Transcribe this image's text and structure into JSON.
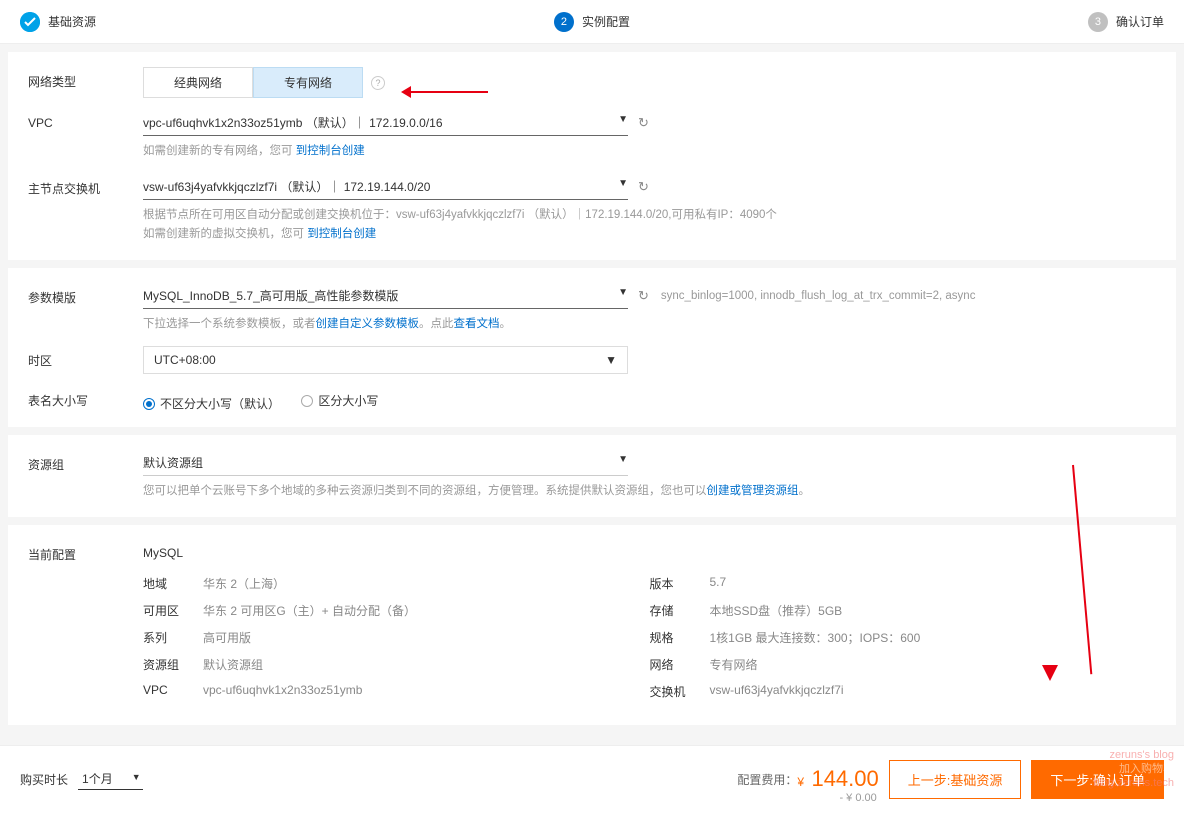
{
  "steps": {
    "s1": "基础资源",
    "s2": "实例配置",
    "s3": "确认订单",
    "n2": "2",
    "n3": "3"
  },
  "network": {
    "label": "网络类型",
    "classic": "经典网络",
    "vpc": "专有网络"
  },
  "vpc": {
    "label": "VPC",
    "value": "vpc-uf6uqhvk1x2n33oz51ymb （默认）｜ 172.19.0.0/16",
    "hint_prefix": "如需创建新的专有网络，您可",
    "hint_link": "到控制台创建"
  },
  "vswitch": {
    "label": "主节点交换机",
    "value": "vsw-uf63j4yafvkkjqczlzf7i （默认）｜ 172.19.144.0/20",
    "hint1": "根据节点所在可用区自动分配或创建交换机位于：vsw-uf63j4yafvkkjqczlzf7i （默认）｜172.19.144.0/20,可用私有IP：4090个",
    "hint2_prefix": "如需创建新的虚拟交换机，您可",
    "hint2_link": "到控制台创建"
  },
  "template": {
    "label": "参数模版",
    "value": "MySQL_InnoDB_5.7_高可用版_高性能参数模版",
    "side": "sync_binlog=1000, innodb_flush_log_at_trx_commit=2, async",
    "hint_prefix": "下拉选择一个系统参数模板，或者",
    "hint_link1": "创建自定义参数模板",
    "hint_mid": "。点此",
    "hint_link2": "查看文档",
    "hint_suffix": "。"
  },
  "tz": {
    "label": "时区",
    "value": "UTC+08:00"
  },
  "tablecase": {
    "label": "表名大小写",
    "opt1": "不区分大小写（默认）",
    "opt2": "区分大小写"
  },
  "resgroup": {
    "label": "资源组",
    "value": "默认资源组",
    "hint_prefix": "您可以把单个云账号下多个地域的多种云资源归类到不同的资源组，方便管理。系统提供默认资源组，您也可以",
    "hint_link": "创建或管理资源组",
    "hint_suffix": "。"
  },
  "current": {
    "label": "当前配置",
    "product": "MySQL",
    "left": {
      "region_k": "地域",
      "region_v": "华东 2（上海）",
      "zone_k": "可用区",
      "zone_v": "华东 2 可用区G（主）+ 自动分配（备）",
      "series_k": "系列",
      "series_v": "高可用版",
      "rg_k": "资源组",
      "rg_v": "默认资源组",
      "vpc_k": "VPC",
      "vpc_v": "vpc-uf6uqhvk1x2n33oz51ymb"
    },
    "right": {
      "ver_k": "版本",
      "ver_v": "5.7",
      "stor_k": "存储",
      "stor_v": "本地SSD盘（推荐）5GB",
      "spec_k": "规格",
      "spec_v": "1核1GB 最大连接数：300；IOPS：600",
      "net_k": "网络",
      "net_v": "专有网络",
      "vsw_k": "交换机",
      "vsw_v": "vsw-uf63j4yafvkkjqczlzf7i"
    }
  },
  "footer": {
    "duration_label": "购买时长",
    "duration_value": "1个月",
    "cost_label": "配置费用：",
    "price_sym": "¥",
    "price": "144.00",
    "price_save": "- ¥ 0.00",
    "prev": "上一步:基础资源",
    "next": "下一步:确认订单",
    "cart": "加入购物车"
  },
  "watermark": {
    "l1": "zeruns's blog",
    "l2": "blog.zeruns.tech"
  }
}
